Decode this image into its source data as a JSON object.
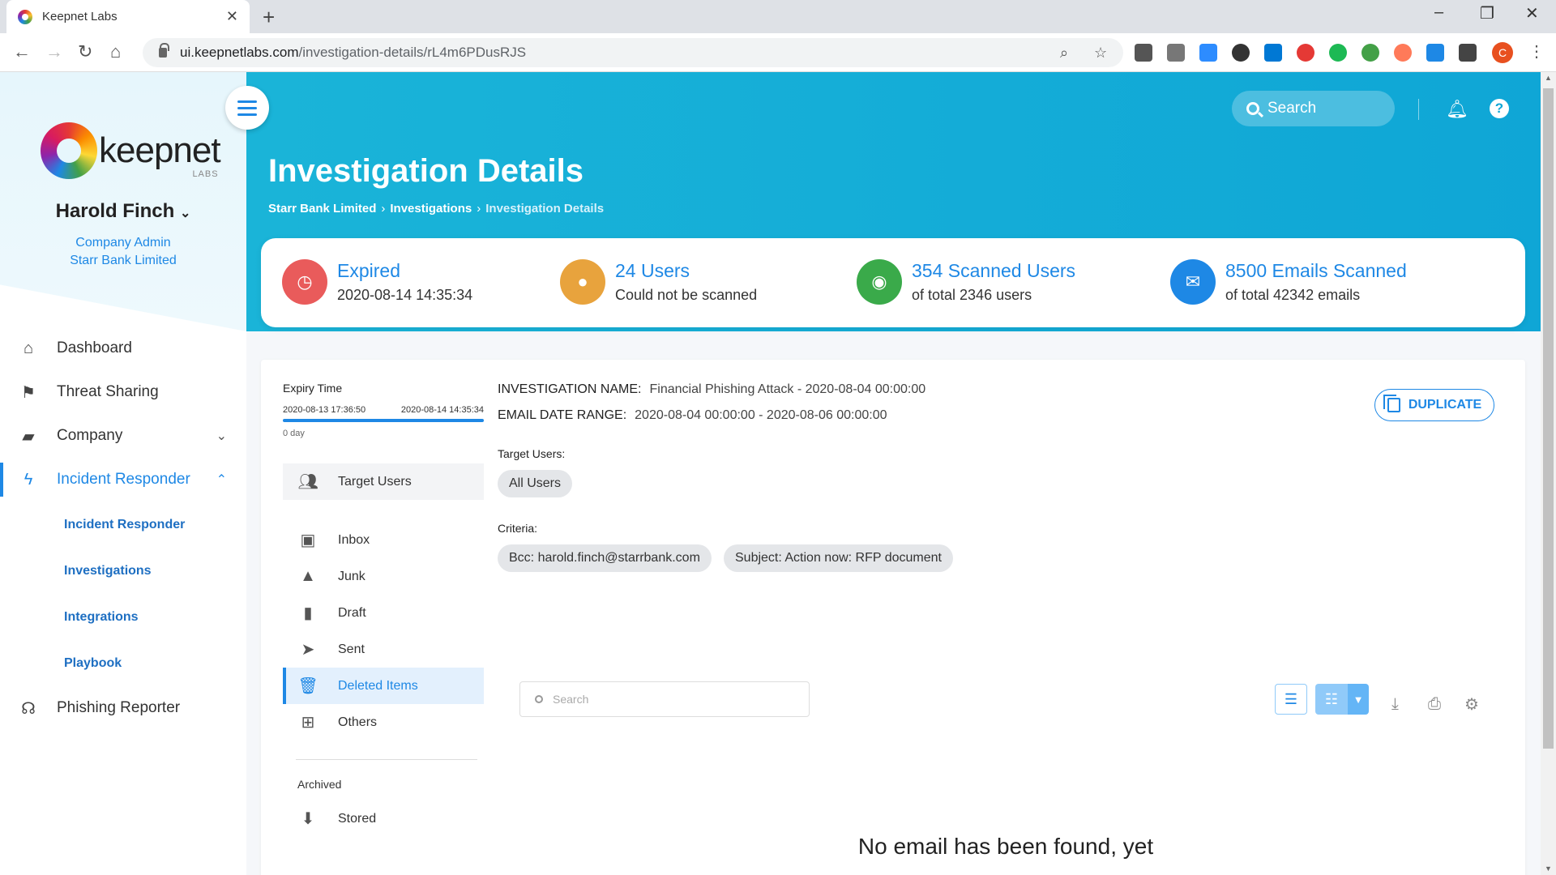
{
  "browser": {
    "tab_title": "Keepnet Labs",
    "url_host": "ui.keepnetlabs.com",
    "url_path": "/investigation-details/rL4m6PDusRJS",
    "profile_initial": "C"
  },
  "sidebar": {
    "logo_text": "keepnet",
    "logo_sub": "LABS",
    "user_name": "Harold Finch",
    "user_role": "Company Admin",
    "user_company": "Starr Bank Limited",
    "menu": [
      {
        "label": "Dashboard",
        "icon": "home-icon"
      },
      {
        "label": "Threat Sharing",
        "icon": "flag-icon"
      },
      {
        "label": "Company",
        "icon": "briefcase-icon"
      },
      {
        "label": "Incident Responder",
        "icon": "bolt-icon"
      },
      {
        "label": "Phishing Reporter",
        "icon": "reporter-icon"
      }
    ],
    "submenu": [
      {
        "label": "Incident Responder"
      },
      {
        "label": "Investigations"
      },
      {
        "label": "Integrations"
      },
      {
        "label": "Playbook"
      }
    ]
  },
  "header": {
    "search_placeholder": "Search",
    "title": "Investigation Details",
    "breadcrumb": [
      "Starr Bank Limited",
      "Investigations",
      "Investigation Details"
    ]
  },
  "stats": [
    {
      "title": "Expired",
      "sub": "2020-08-14 14:35:34",
      "color": "#e95b5b",
      "icon": "clock-icon"
    },
    {
      "title": "24 Users",
      "sub": "Could not be scanned",
      "color": "#e8a33d",
      "icon": "user-icon"
    },
    {
      "title": "354 Scanned Users",
      "sub": "of total 2346 users",
      "color": "#3aaa4a",
      "icon": "user-check-icon"
    },
    {
      "title": "8500 Emails Scanned",
      "sub": "of total 42342 emails",
      "color": "#1e88e5",
      "icon": "mail-icon"
    }
  ],
  "expiry": {
    "label": "Expiry Time",
    "start": "2020-08-13 17:36:50",
    "end": "2020-08-14 14:35:34",
    "remaining": "0 day"
  },
  "folders": {
    "target_users": "Target Users",
    "items": [
      "Inbox",
      "Junk",
      "Draft",
      "Sent",
      "Deleted Items",
      "Others"
    ],
    "archived_label": "Archived",
    "stored": "Stored"
  },
  "investigation": {
    "name_label": "INVESTIGATION NAME:",
    "name_value": "Financial Phishing Attack - 2020-08-04 00:00:00",
    "range_label": "EMAIL DATE RANGE:",
    "range_value": "2020-08-04 00:00:00 - 2020-08-06 00:00:00",
    "duplicate_label": "DUPLICATE",
    "target_users_label": "Target Users:",
    "target_chip": "All Users",
    "criteria_label": "Criteria:",
    "criteria": [
      "Bcc: harold.finch@starrbank.com",
      "Subject: Action now: RFP document"
    ],
    "search_placeholder": "Search",
    "empty_message": "No email has been found, yet"
  }
}
